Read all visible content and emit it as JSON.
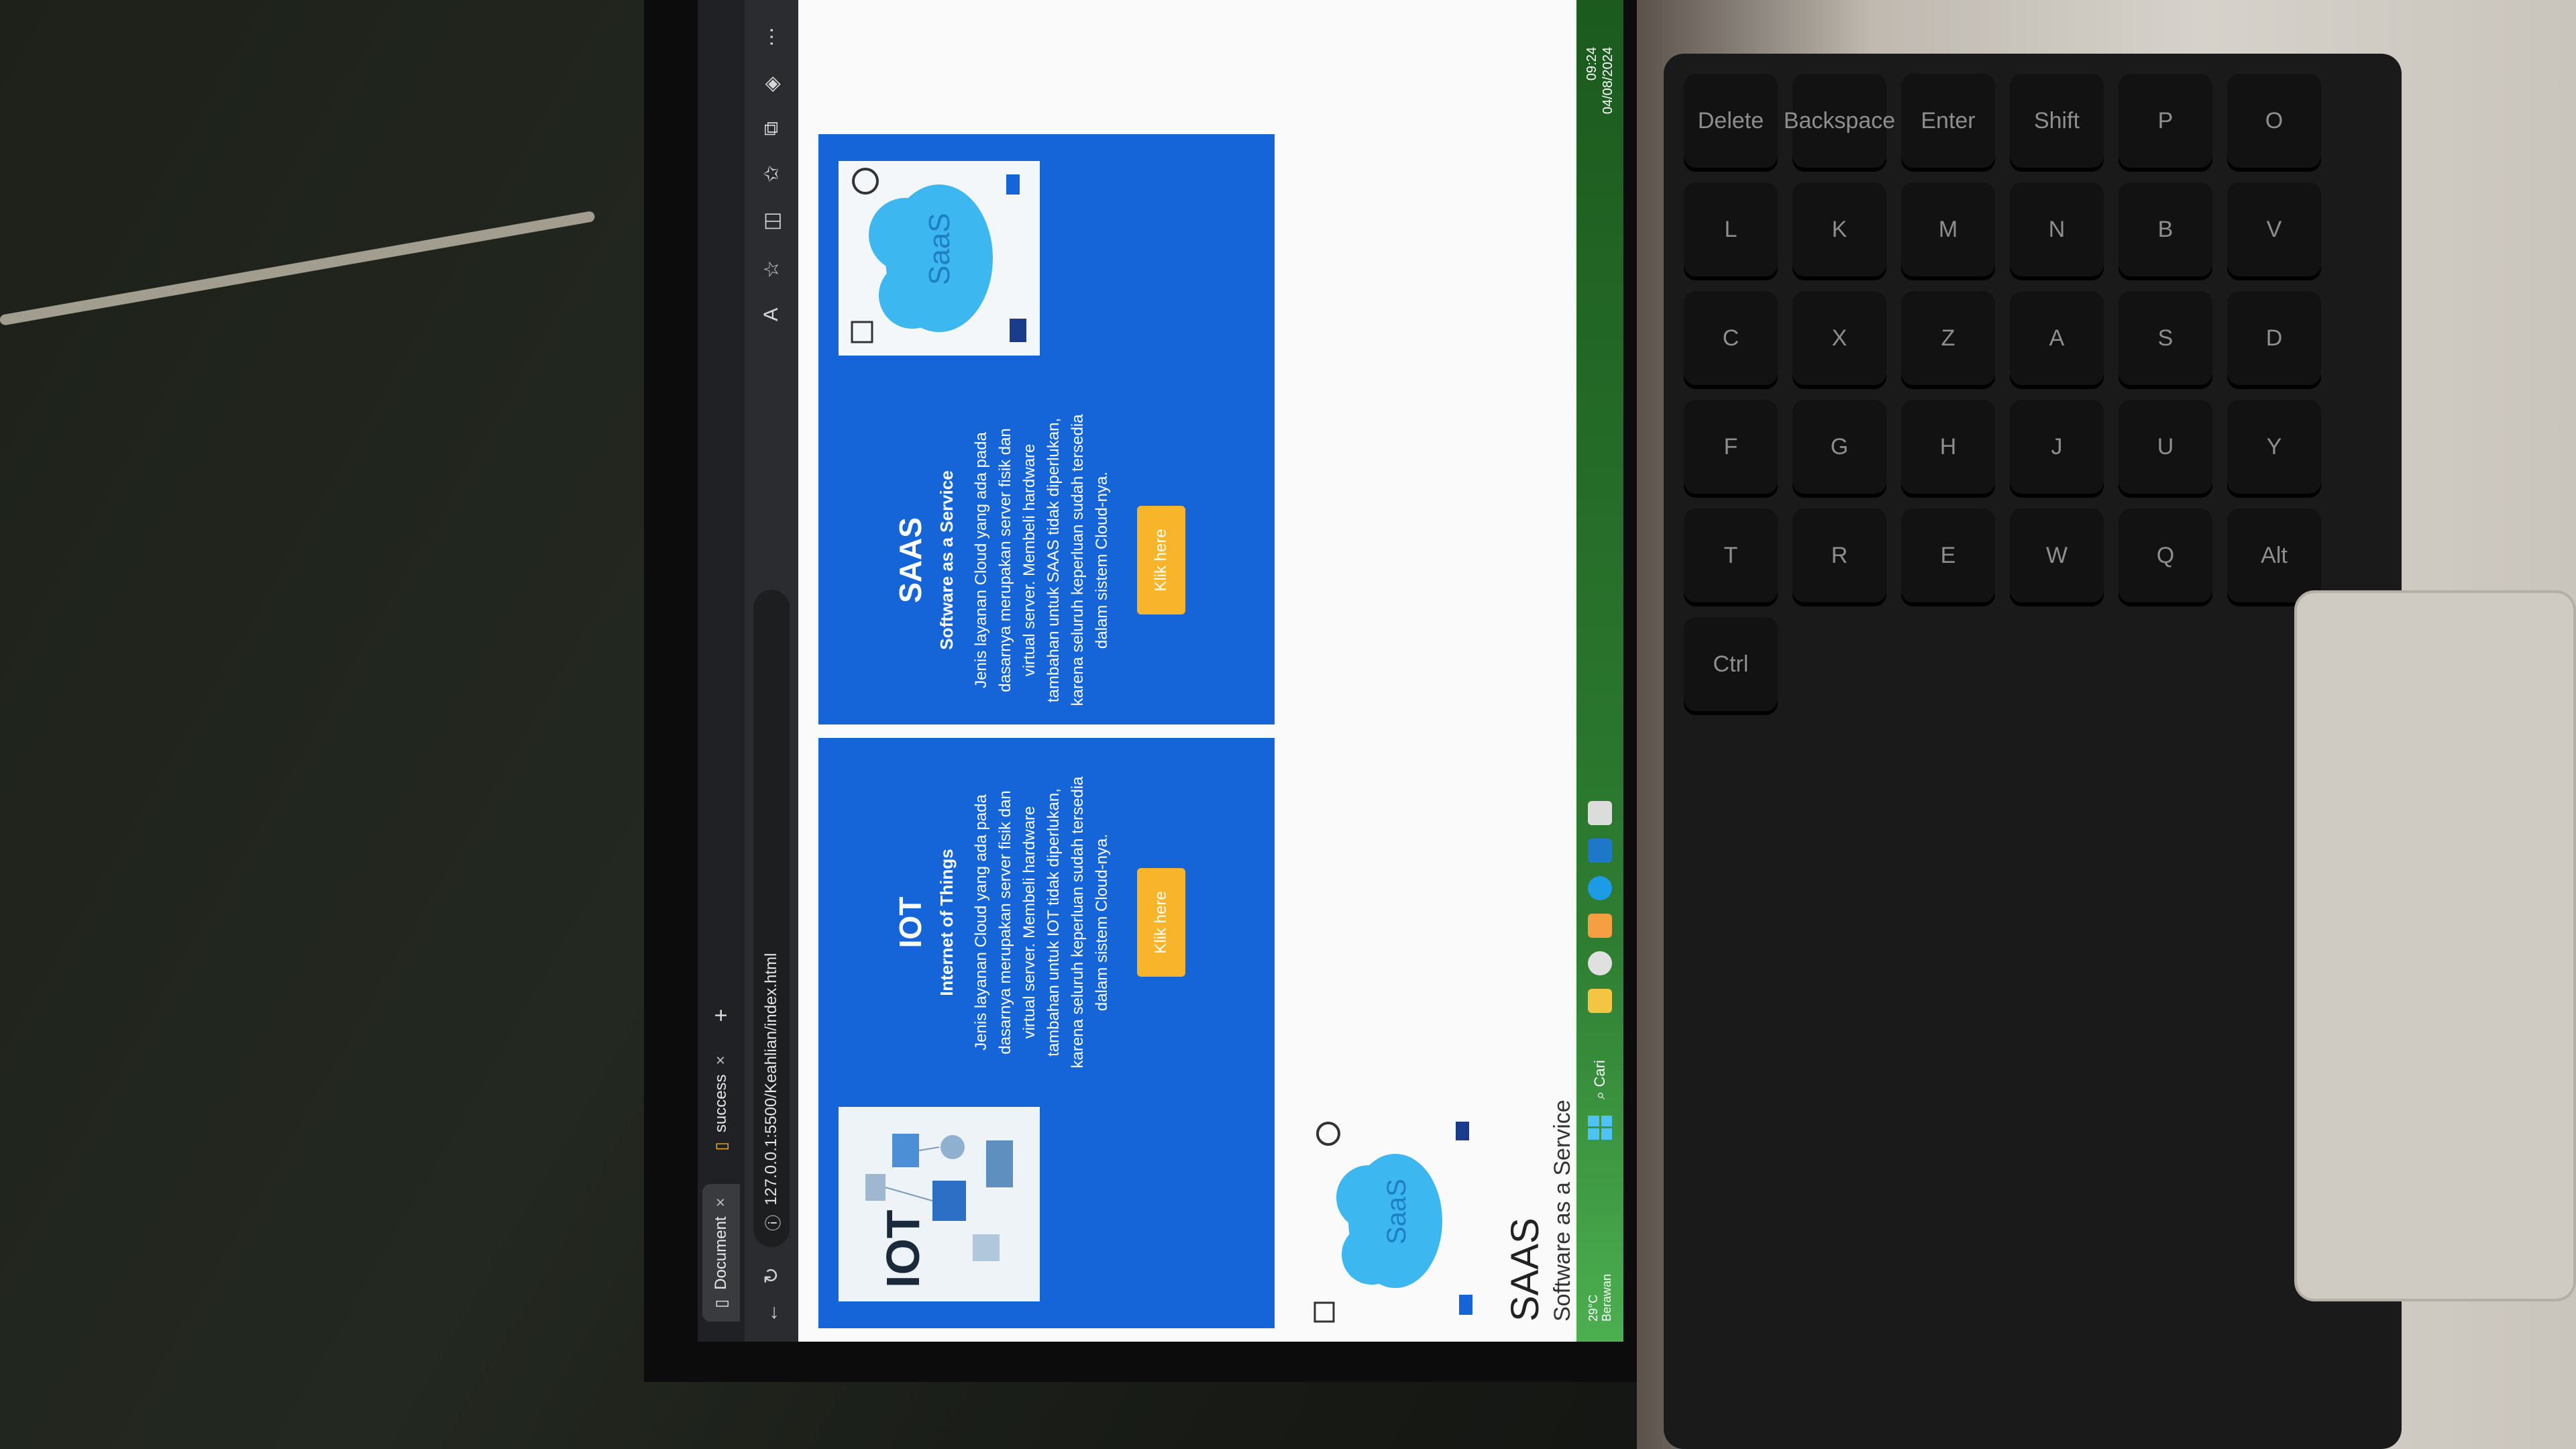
{
  "browser": {
    "tabs": [
      {
        "label": "Document",
        "active": true
      },
      {
        "label": "success",
        "active": false
      }
    ],
    "url": "127.0.0.1:5500/Keahlian/index.html"
  },
  "cards": {
    "iot": {
      "image_label": "IOT",
      "title": "IOT",
      "subtitle": "Internet of Things",
      "description": "Jenis layanan Cloud yang ada pada dasarnya merupakan server fisik dan virtual server. Membeli hardware tambahan untuk IOT tidak diperlukan, karena seluruh keperluan sudah tersedia dalam sistem Cloud-nya.",
      "button_label": "Klik here"
    },
    "saas": {
      "image_label": "SaaS",
      "title": "SAAS",
      "subtitle": "Software as a Service",
      "description": "Jenis layanan Cloud yang ada pada dasarnya merupakan server fisik dan virtual server. Membeli hardware tambahan untuk SAAS tidak diperlukan, karena seluruh keperluan sudah tersedia dalam sistem Cloud-nya.",
      "button_label": "Klik here"
    }
  },
  "lower_section": {
    "image_label": "SaaS",
    "title": "SAAS",
    "subtitle": "Software as a Service"
  },
  "taskbar": {
    "weather_temp": "29°C",
    "weather_desc": "Berawan",
    "search_placeholder": "Cari",
    "time": "09:24",
    "date": "04/08/2024"
  },
  "keyboard": {
    "keys": [
      "Delete",
      "Backspace",
      "Enter",
      "Shift",
      "P",
      "O",
      "L",
      "K",
      "M",
      "N",
      "B",
      "V",
      "C",
      "X",
      "Z",
      "A",
      "S",
      "D",
      "F",
      "G",
      "H",
      "J",
      "U",
      "Y",
      "T",
      "R",
      "E",
      "W",
      "Q",
      "Alt",
      "Ctrl"
    ]
  }
}
